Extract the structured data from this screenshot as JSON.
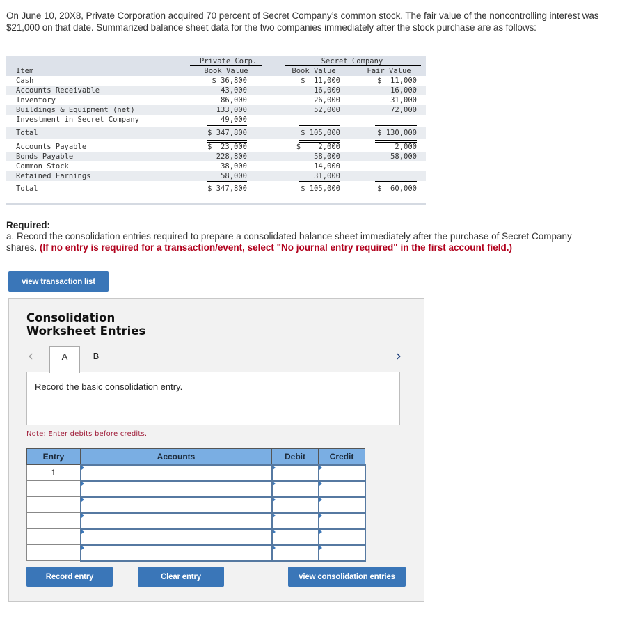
{
  "intro": {
    "text": "On June 10, 20X8, Private Corporation acquired 70 percent of Secret Company’s common stock. The fair value of the noncontrolling interest was $21,000 on that date. Summarized balance sheet data for the two companies immediately after the stock purchase are as follows:"
  },
  "balance_sheet": {
    "group_headers": {
      "private": "Private Corp.",
      "secret": "Secret Company"
    },
    "column_headers": {
      "item": "Item",
      "private_book": "Book Value",
      "secret_book": "Book Value",
      "secret_fair": "Fair Value"
    },
    "assets": [
      {
        "item": "Cash",
        "private_book": "$ 36,800",
        "secret_book": "$  11,000",
        "secret_fair": "$  11,000"
      },
      {
        "item": "Accounts Receivable",
        "private_book": "43,000",
        "secret_book": "16,000",
        "secret_fair": "16,000"
      },
      {
        "item": "Inventory",
        "private_book": "86,000",
        "secret_book": "26,000",
        "secret_fair": "31,000"
      },
      {
        "item": "Buildings & Equipment (net)",
        "private_book": "133,000",
        "secret_book": "52,000",
        "secret_fair": "72,000"
      },
      {
        "item": "Investment in Secret Company",
        "private_book": "49,000",
        "secret_book": "",
        "secret_fair": ""
      }
    ],
    "assets_total": {
      "item": "Total",
      "private_book": "$ 347,800",
      "secret_book": "$ 105,000",
      "secret_fair": "$ 130,000"
    },
    "liabilities_equity": [
      {
        "item": "Accounts Payable",
        "private_book": "$  23,000",
        "secret_book": "$    2,000",
        "secret_fair": "2,000"
      },
      {
        "item": "Bonds Payable",
        "private_book": "228,800",
        "secret_book": "58,000",
        "secret_fair": "58,000"
      },
      {
        "item": "Common Stock",
        "private_book": "38,000",
        "secret_book": "14,000",
        "secret_fair": ""
      },
      {
        "item": "Retained Earnings",
        "private_book": "58,000",
        "secret_book": "31,000",
        "secret_fair": ""
      }
    ],
    "liabilities_total": {
      "item": "Total",
      "private_book": "$ 347,800",
      "secret_book": "$ 105,000",
      "secret_fair": "$  60,000"
    }
  },
  "required": {
    "title": "Required:",
    "text": "a. Record the consolidation entries required to prepare a consolidated balance sheet immediately after the purchase of Secret Company shares. ",
    "instruction": "(If no entry is required for a transaction/event, select \"No journal entry required\" in the first account field.)"
  },
  "buttons": {
    "view_transaction_list": "view transaction list",
    "record_entry": "Record entry",
    "clear_entry": "Clear entry",
    "view_consolidation_entries": "view consolidation entries"
  },
  "panel": {
    "title_line1": "Consolidation",
    "title_line2": "Worksheet Entries",
    "prev_icon": "‹",
    "next_icon": "›",
    "tabs": [
      {
        "label": "A",
        "active": true
      },
      {
        "label": "B",
        "active": false
      }
    ],
    "prompt": "Record the basic consolidation entry.",
    "note": "Note: Enter debits before credits."
  },
  "journal": {
    "headers": {
      "entry": "Entry",
      "accounts": "Accounts",
      "debit": "Debit",
      "credit": "Credit"
    },
    "rows": [
      {
        "entry": "1",
        "account": "",
        "debit": "",
        "credit": ""
      },
      {
        "entry": "",
        "account": "",
        "debit": "",
        "credit": ""
      },
      {
        "entry": "",
        "account": "",
        "debit": "",
        "credit": ""
      },
      {
        "entry": "",
        "account": "",
        "debit": "",
        "credit": ""
      },
      {
        "entry": "",
        "account": "",
        "debit": "",
        "credit": ""
      },
      {
        "entry": "",
        "account": "",
        "debit": "",
        "credit": ""
      }
    ]
  }
}
